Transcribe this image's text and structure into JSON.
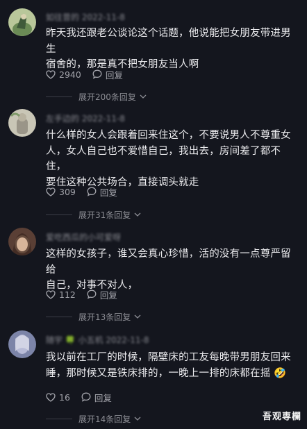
{
  "comments": [
    {
      "author": "如往昔的  2022-11-8",
      "text_lines": [
        "昨天我还跟老公谈论这个话题，他说能把女朋友带进男生",
        "宿舍的，那是真不把女朋友当人啊"
      ],
      "likes": "2940",
      "reply_label": "回复",
      "expand_label": "展开200条回复"
    },
    {
      "author": "左手边的  2022-11-8",
      "text_lines": [
        "什么样的女人会跟着回来住这个，不要说男人不尊重女",
        "人，女人自己也不爱惜自己，我出去，房间差了都不住，",
        "要住这种公共场合，直接调头就走"
      ],
      "likes": "309",
      "reply_label": "回复",
      "expand_label": "展开31条回复"
    },
    {
      "author": "爱吃西瓜的小可爱呀",
      "text_lines": [
        "这样的女孩子，谁又会真心珍惜，活的没有一点尊严留给",
        "自己，对事不对人，"
      ],
      "likes": "112",
      "reply_label": "回复",
      "expand_label": "展开13条回复"
    },
    {
      "author": "随宇 🍀 小五机  2022-11-8",
      "text_lines": [
        "我以前在工厂的时候，隔壁床的工友每晚带男朋友回来",
        "睡，那时候又是铁床排的，一晚上一排的床都在摇 🤣"
      ],
      "likes": "16",
      "reply_label": "回复",
      "expand_label": "展开14条回复"
    }
  ],
  "watermark": "吾观専欄",
  "icons": {
    "like": "heart-outline-icon",
    "reply": "speech-bubble-icon",
    "expand": "chevron-down-icon"
  },
  "colors": {
    "background": "#14161e",
    "text": "#ececef",
    "muted": "#8c8d94"
  }
}
